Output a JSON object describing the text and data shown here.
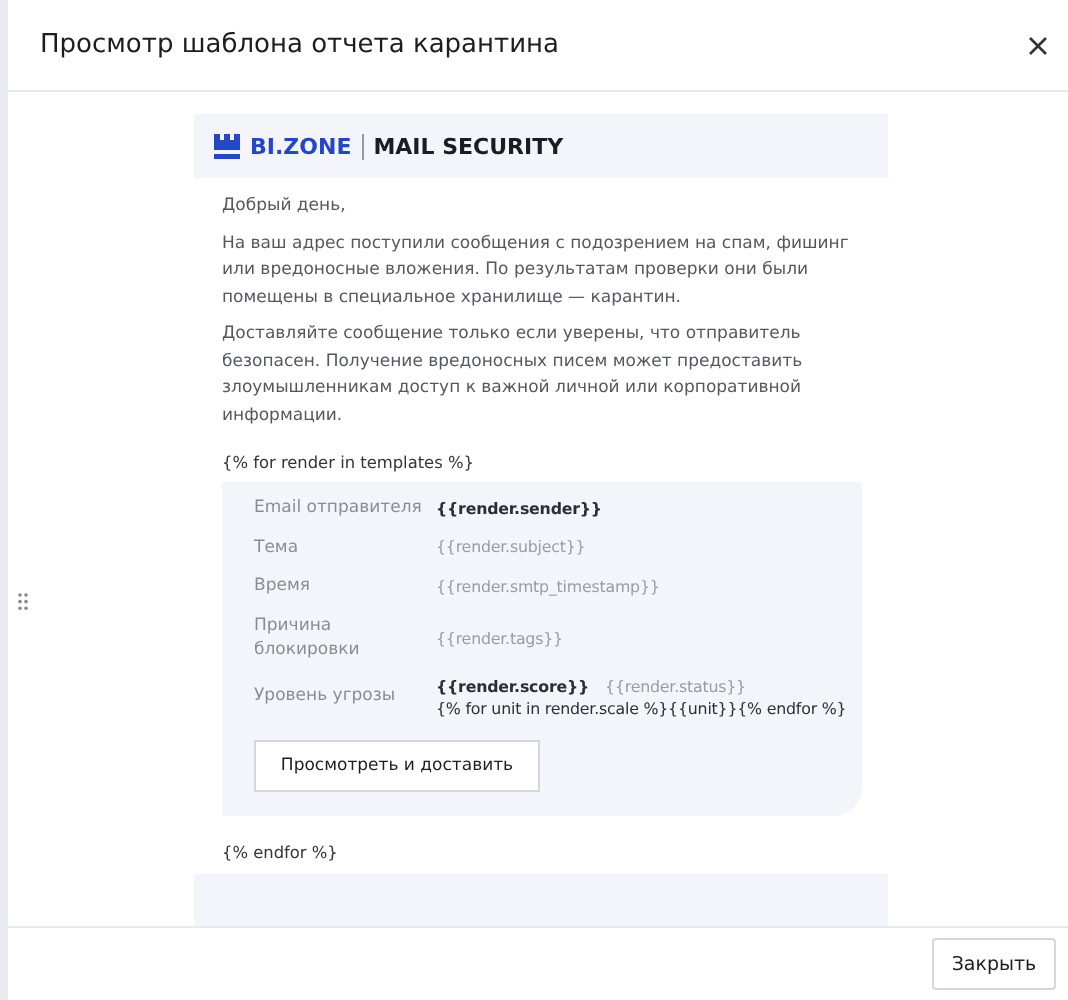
{
  "dialog": {
    "title": "Просмотр шаблона отчета карантина"
  },
  "email": {
    "brand": "BI.ZONE",
    "product": "MAIL SECURITY",
    "greeting": "Добрый день,",
    "paragraphs": [
      "На ваш адрес поступили сообщения с подозрением на спам, фишинг или вредоносные вложения. По результатам проверки они были помещены в специальное хранилище — карантин.",
      "Доставляйте сообщение только если уверены, что отправитель безопасен. Получение вредоносных писем может предоставить злоумышленникам доступ к важной личной или корпоративной информации."
    ],
    "loop_start": "{% for render in templates %}",
    "rows": [
      {
        "label": "Email отправителя",
        "lines": [
          [
            {
              "text": "{{render.sender}}",
              "kind": "strong"
            }
          ]
        ]
      },
      {
        "label": "Тема",
        "lines": [
          [
            {
              "text": "{{render.subject}}",
              "kind": "muted"
            }
          ]
        ]
      },
      {
        "label": "Время",
        "lines": [
          [
            {
              "text": "{{render.smtp_timestamp}}",
              "kind": "muted"
            }
          ]
        ]
      },
      {
        "label": "Причина блокировки",
        "lines": [
          [
            {
              "text": "{{render.tags}}",
              "kind": "muted"
            }
          ]
        ]
      },
      {
        "label": "Уровень угрозы",
        "lines": [
          [
            {
              "text": "{{render.score}}",
              "kind": "strong"
            },
            {
              "text": "{{render.status}}",
              "kind": "muted"
            }
          ],
          [
            {
              "text": "{% for unit in render.scale %}{{unit}}{% endfor %}",
              "kind": "plain"
            }
          ]
        ]
      }
    ],
    "action_button": "Просмотреть и доставить",
    "loop_end": "{% endfor %}"
  },
  "footer": {
    "close_button": "Закрыть"
  }
}
